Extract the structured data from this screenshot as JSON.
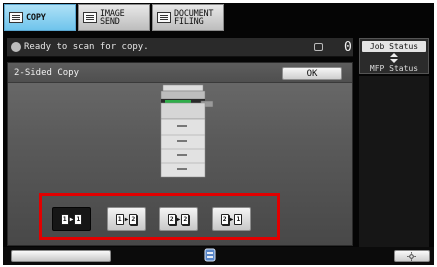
{
  "tabs": [
    {
      "label": "COPY",
      "active": true
    },
    {
      "label": "IMAGE SEND",
      "active": false
    },
    {
      "label": "DOCUMENT\nFILING",
      "active": false
    }
  ],
  "status": {
    "message": "Ready to scan for copy.",
    "copy_count": "0"
  },
  "side_panel": {
    "job_status": "Job Status",
    "mfp_status": "MFP Status"
  },
  "panel": {
    "title": "2-Sided Copy",
    "ok_label": "OK"
  },
  "modes": [
    {
      "from": "1",
      "to": "1",
      "from_duplex": false,
      "to_duplex": false,
      "selected": true
    },
    {
      "from": "1",
      "to": "2",
      "from_duplex": false,
      "to_duplex": true,
      "selected": false
    },
    {
      "from": "2",
      "to": "2",
      "from_duplex": true,
      "to_duplex": true,
      "selected": false
    },
    {
      "from": "2",
      "to": "1",
      "from_duplex": true,
      "to_duplex": false,
      "selected": false
    }
  ],
  "colors": {
    "active_tab": "#6fc4ec",
    "highlight_frame": "#e10000",
    "machine_tray": "#2fae4a"
  },
  "icons": {
    "copy": "copy-icon",
    "send": "image-send-icon",
    "filing": "document-filing-icon",
    "status": "scanner-status-icon",
    "brightness": "sun-icon"
  }
}
